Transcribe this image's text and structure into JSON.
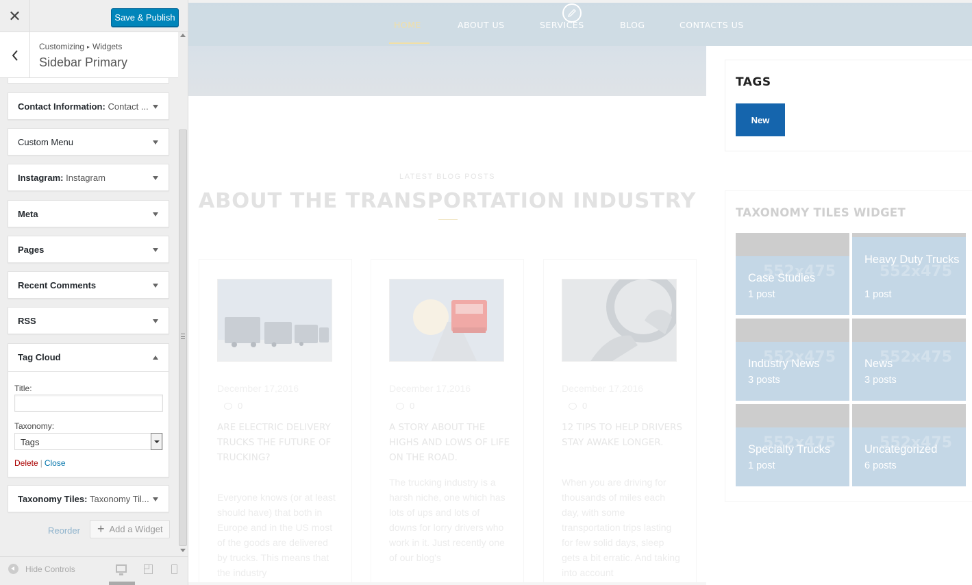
{
  "customizer": {
    "close_label": "✕",
    "save_label": "Save & Publish",
    "breadcrumb": {
      "root": "Customizing",
      "separator": "▸",
      "section": "Widgets"
    },
    "panel_title": "Sidebar Primary",
    "widgets": [
      {
        "name": "Contact Information",
        "sub": "Contact ...",
        "state": "collapsed"
      },
      {
        "name": "Custom Menu",
        "sub": "",
        "state": "collapsed"
      },
      {
        "name": "Instagram",
        "sub": "Instagram",
        "state": "collapsed"
      },
      {
        "name": "Meta",
        "sub": "",
        "state": "collapsed"
      },
      {
        "name": "Pages",
        "sub": "",
        "state": "collapsed"
      },
      {
        "name": "Recent Comments",
        "sub": "",
        "state": "collapsed"
      },
      {
        "name": "RSS",
        "sub": "",
        "state": "collapsed"
      },
      {
        "name": "Tag Cloud",
        "sub": "",
        "state": "expanded"
      },
      {
        "name": "Taxonomy Tiles",
        "sub": "Taxonomy Til...",
        "state": "collapsed"
      }
    ],
    "name_suffix": ":",
    "tag_cloud_form": {
      "title_label": "Title:",
      "title_value": "",
      "taxonomy_label": "Taxonomy:",
      "taxonomy_value": "Tags",
      "delete_label": "Delete",
      "pipe": "|",
      "close_label": "Close"
    },
    "reorder_label": "Reorder",
    "add_widget_label": "Add a Widget",
    "add_widget_icon": "+",
    "hide_controls_label": "Hide Controls",
    "preview_devices": [
      "desktop",
      "tablet",
      "mobile"
    ],
    "active_device": "desktop",
    "accent_color": "#0085ba"
  },
  "site": {
    "nav": [
      "HOME",
      "ABOUT US",
      "SERVICES",
      "BLOG",
      "CONTACTS US"
    ],
    "active_nav": "HOME",
    "tags_widget": {
      "heading": "TAGS",
      "tags": [
        "New"
      ]
    },
    "blog": {
      "eyebrow": "LATEST BLOG POSTS",
      "title": "ABOUT THE TRANSPORTATION INDUSTRY",
      "posts": [
        {
          "date": "December 17,2016",
          "comments": "0",
          "title": "ARE ELECTRIC DELIVERY TRUCKS THE FUTURE OF TRUCKING?",
          "excerpt": "Everyone knows (or at least should have) that both in Europe and in the US most of the goods are delivered by trucks. This means that the industry"
        },
        {
          "date": "December 17,2016",
          "comments": "0",
          "title": "A STORY ABOUT THE HIGHS AND LOWS OF LIFE ON THE ROAD.",
          "excerpt": "The trucking industry is a harsh niche, one which has lots of ups and lots of downs for lorry drivers who work in it. Just recently one of our blog's"
        },
        {
          "date": "December 17,2016",
          "comments": "0",
          "title": "12 TIPS TO HELP DRIVERS STAY AWAKE LONGER.",
          "excerpt": "When you are driving for thousands of miles each day, with some transportation trips lasting for few solid days, sleep gets a bit erratic. And taking into account"
        }
      ]
    },
    "taxonomy_tiles": {
      "heading": "TAXONOMY TILES WIDGET",
      "placeholder": "552x475",
      "tiles": [
        {
          "name": "Case Studies",
          "count": "1 post"
        },
        {
          "name": "Heavy Duty Trucks",
          "count": "1 post"
        },
        {
          "name": "Industry News",
          "count": "3 posts"
        },
        {
          "name": "News",
          "count": "3 posts"
        },
        {
          "name": "Specialty Trucks",
          "count": "1 post"
        },
        {
          "name": "Uncategorized",
          "count": "6 posts"
        }
      ]
    },
    "tag_color": "#1565ad",
    "nav_active_color": "#f2dfa6"
  }
}
